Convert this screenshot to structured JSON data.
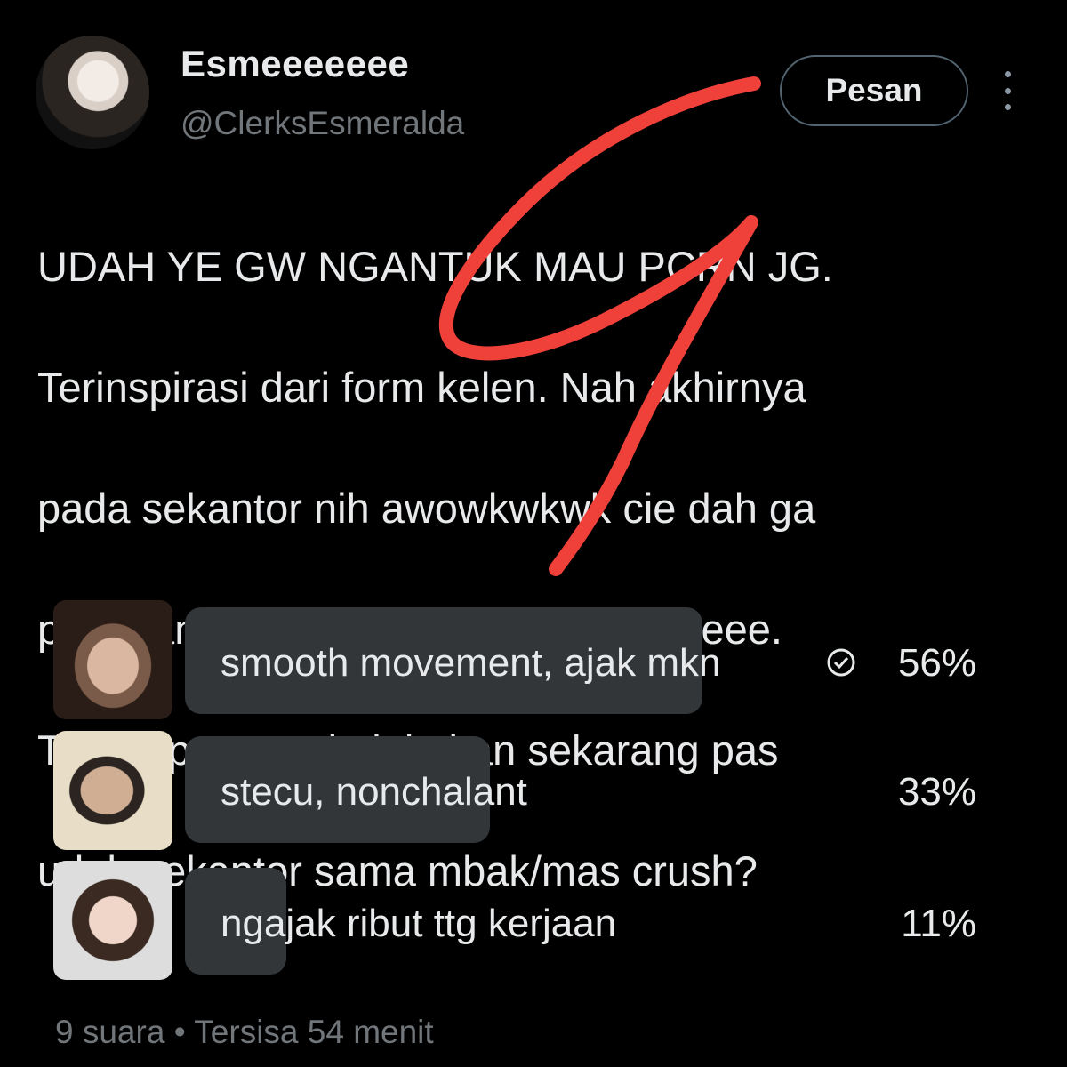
{
  "author": {
    "display_name": "Esmeeeeeee",
    "handle": "@ClerksEsmeralda"
  },
  "actions": {
    "message_label": "Pesan",
    "more_icon": "more-vertical-icon"
  },
  "tweet": {
    "lines": [
      "UDAH YE GW NGANTUK MAU PCRN JG.",
      "Terinspirasi dari form kelen. Nah akhirnya",
      "pada sekantor nih awowkwkwk cie dah ga",
      "papasan di kantin/coffeeshop/lift lageee.",
      "Then apa yang lu lakukan sekarang pas",
      "udah sekantor sama mbak/mas crush?"
    ]
  },
  "poll": {
    "options": [
      {
        "label": "smooth movement, ajak mkn",
        "percent": "56%",
        "value": 56,
        "voted": true
      },
      {
        "label": "stecu, nonchalant",
        "percent": "33%",
        "value": 33,
        "voted": false
      },
      {
        "label": "ngajak ribut ttg kerjaan",
        "percent": "11%",
        "value": 11,
        "voted": false
      }
    ],
    "votes": "9 suara",
    "separator": "•",
    "time_left": "Tersisa 54 menit"
  },
  "colors": {
    "background": "#000000",
    "text": "#e7e9ea",
    "muted": "#71767b",
    "bar": "#333639",
    "annotation": "#f0403a"
  }
}
